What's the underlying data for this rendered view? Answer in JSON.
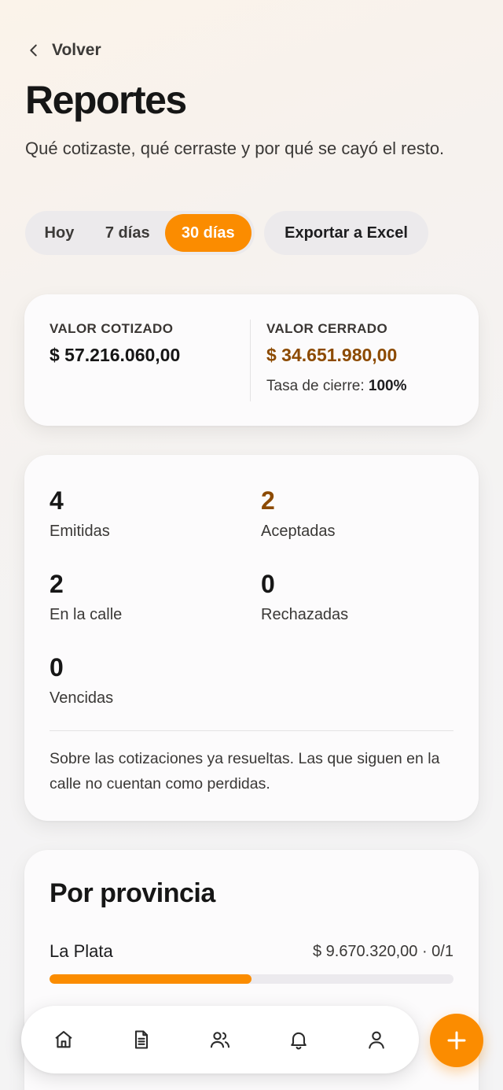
{
  "header": {
    "back_label": "Volver",
    "title": "Reportes",
    "subtitle": "Qué cotizaste, qué cerraste y por qué se cayó el resto."
  },
  "filters": {
    "periods": [
      {
        "label": "Hoy",
        "active": false
      },
      {
        "label": "7 días",
        "active": false
      },
      {
        "label": "30 días",
        "active": true
      }
    ],
    "export_label": "Exportar a Excel"
  },
  "summary": {
    "quoted_label": "VALOR COTIZADO",
    "quoted_value": "$ 57.216.060,00",
    "closed_label": "VALOR CERRADO",
    "closed_value": "$ 34.651.980,00",
    "close_rate_label": "Tasa de cierre:",
    "close_rate_value": "100%"
  },
  "stats": {
    "items": [
      {
        "value": "4",
        "label": "Emitidas"
      },
      {
        "value": "2",
        "label": "Aceptadas"
      },
      {
        "value": "2",
        "label": "En la calle"
      },
      {
        "value": "0",
        "label": "Rechazadas"
      },
      {
        "value": "0",
        "label": "Vencidas"
      }
    ],
    "note": "Sobre las cotizaciones ya resueltas. Las que siguen en la calle no cuentan como perdidas."
  },
  "by_province": {
    "title": "Por provincia",
    "rows": [
      {
        "name": "La Plata",
        "amount": "$ 9.670.320,00 · 0/1",
        "share": 0.5
      }
    ]
  },
  "colors": {
    "accent": "#fb8c00",
    "accent_text": "#8c4a00"
  },
  "nav": {
    "items": [
      "home-icon",
      "document-icon",
      "users-icon",
      "bell-icon",
      "user-icon"
    ],
    "fab_icon": "plus-icon"
  }
}
